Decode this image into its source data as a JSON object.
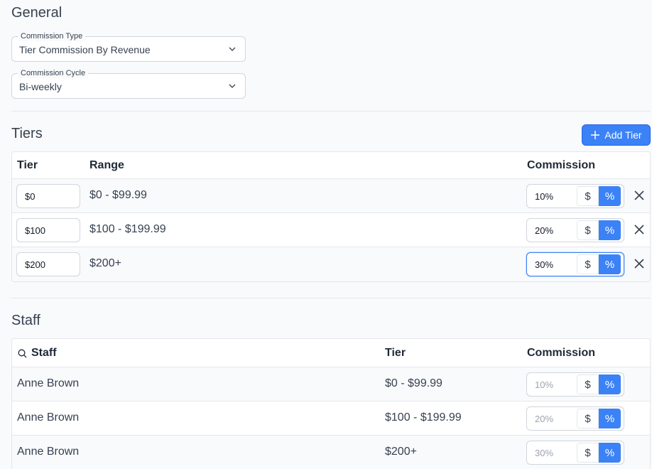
{
  "general": {
    "title": "General",
    "commission_type": {
      "label": "Commission Type",
      "value": "Tier Commission By Revenue"
    },
    "commission_cycle": {
      "label": "Commission Cycle",
      "value": "Bi-weekly"
    }
  },
  "tiers": {
    "title": "Tiers",
    "add_button_label": "Add Tier",
    "headers": {
      "tier": "Tier",
      "range": "Range",
      "commission": "Commission"
    },
    "rows": [
      {
        "tier": "$0",
        "range": "$0 - $99.99",
        "commission": "10%"
      },
      {
        "tier": "$100",
        "range": "$100 - $199.99",
        "commission": "20%"
      },
      {
        "tier": "$200",
        "range": "$200+",
        "commission": "30%"
      }
    ],
    "dollar_symbol": "$",
    "percent_symbol": "%"
  },
  "staff": {
    "title": "Staff",
    "headers": {
      "staff": "Staff",
      "tier": "Tier",
      "commission": "Commission"
    },
    "rows": [
      {
        "name": "Anne Brown",
        "tier": "$0 - $99.99",
        "commission": "10%"
      },
      {
        "name": "Anne Brown",
        "tier": "$100 - $199.99",
        "commission": "20%"
      },
      {
        "name": "Anne Brown",
        "tier": "$200+",
        "commission": "30%"
      }
    ]
  },
  "colors": {
    "accent": "#3b82f6",
    "border": "#e5e7eb",
    "background": "#f9fafb"
  },
  "icons": {
    "chevron": "chevron-down-icon",
    "plus": "plus-icon",
    "close": "close-icon",
    "search": "search-icon"
  }
}
